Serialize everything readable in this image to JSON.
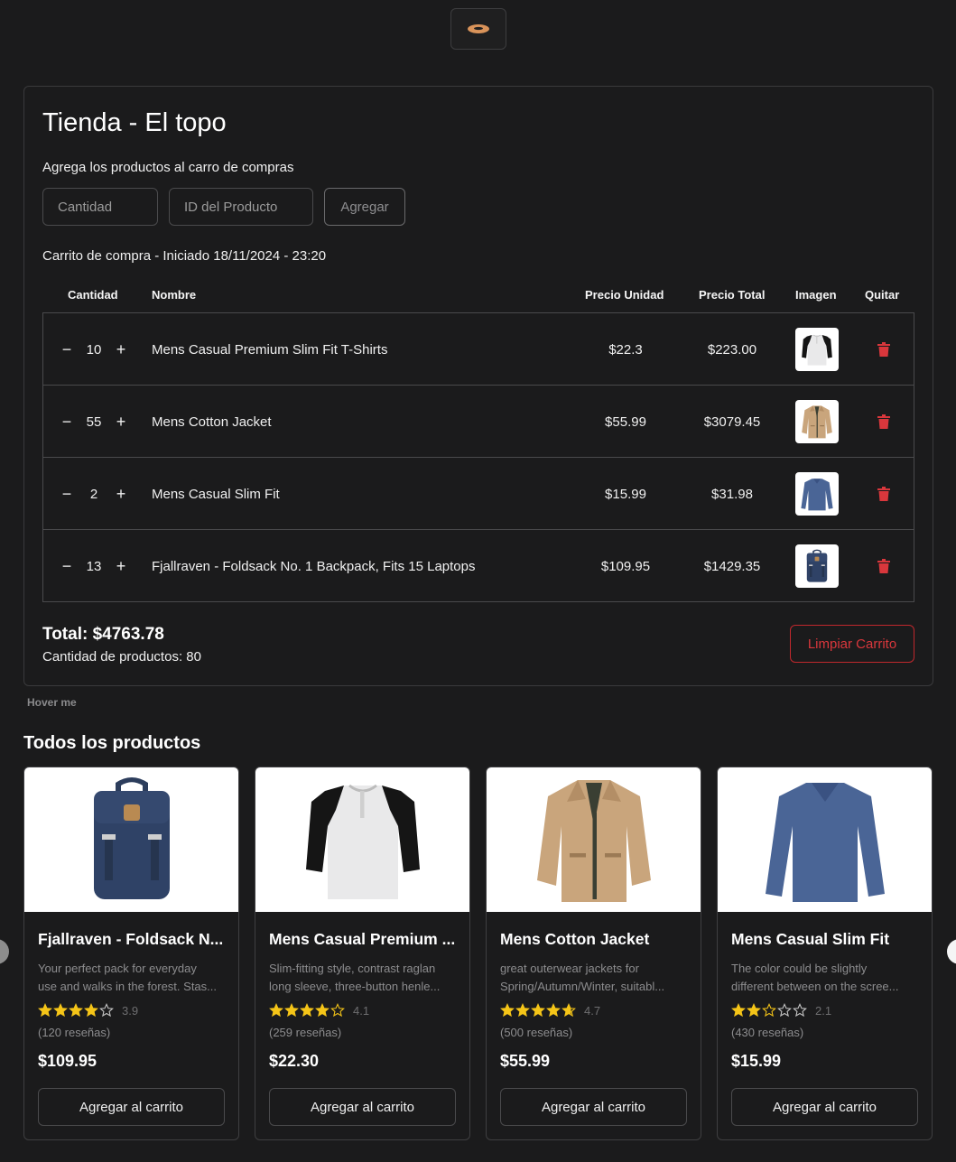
{
  "logo": {
    "icon": "bagel-icon"
  },
  "cart": {
    "title": "Tienda - El topo",
    "subtitle": "Agrega los productos al carro de compras",
    "qty_placeholder": "Cantidad",
    "id_placeholder": "ID del Producto",
    "add_label": "Agregar",
    "started": "Carrito de compra - Iniciado 18/11/2024 - 23:20",
    "headers": {
      "qty": "Cantidad",
      "name": "Nombre",
      "unit": "Precio Unidad",
      "total": "Precio Total",
      "image": "Imagen",
      "remove": "Quitar"
    },
    "rows": [
      {
        "qty": "10",
        "name": "Mens Casual Premium Slim Fit T-Shirts",
        "unit": "$22.3",
        "total": "$223.00",
        "image": "raglan-shirt"
      },
      {
        "qty": "55",
        "name": "Mens Cotton Jacket",
        "unit": "$55.99",
        "total": "$3079.45",
        "image": "jacket"
      },
      {
        "qty": "2",
        "name": "Mens Casual Slim Fit",
        "unit": "$15.99",
        "total": "$31.98",
        "image": "longsleeve"
      },
      {
        "qty": "13",
        "name": "Fjallraven - Foldsack No. 1 Backpack, Fits 15 Laptops",
        "unit": "$109.95",
        "total": "$1429.35",
        "image": "backpack"
      }
    ],
    "total_label": "Total: $4763.78",
    "count_label": "Cantidad de productos: 80",
    "clear_label": "Limpiar Carrito"
  },
  "hover_text": "Hover me",
  "products_title": "Todos los productos",
  "products": [
    {
      "title": "Fjallraven - Foldsack N...",
      "desc1": "Your perfect pack for everyday",
      "desc2": "use and walks in the forest. Stas...",
      "rating": 3.9,
      "rating_label": "3.9",
      "reviews": "(120 reseñas)",
      "price": "$109.95",
      "button": "Agregar al carrito",
      "image": "backpack"
    },
    {
      "title": "Mens Casual Premium ...",
      "desc1": "Slim-fitting style, contrast raglan",
      "desc2": "long sleeve, three-button henle...",
      "rating": 4.1,
      "rating_label": "4.1",
      "reviews": "(259 reseñas)",
      "price": "$22.30",
      "button": "Agregar al carrito",
      "image": "raglan-shirt"
    },
    {
      "title": "Mens Cotton Jacket",
      "desc1": "great outerwear jackets for",
      "desc2": "Spring/Autumn/Winter, suitabl...",
      "rating": 4.7,
      "rating_label": "4.7",
      "reviews": "(500 reseñas)",
      "price": "$55.99",
      "button": "Agregar al carrito",
      "image": "jacket"
    },
    {
      "title": "Mens Casual Slim Fit",
      "desc1": "The color could be slightly",
      "desc2": "different between on the scree...",
      "rating": 2.1,
      "rating_label": "2.1",
      "reviews": "(430 reseñas)",
      "price": "$15.99",
      "button": "Agregar al carrito",
      "image": "longsleeve"
    }
  ],
  "colors": {
    "background": "#1b1b1c",
    "danger": "#d9373c",
    "star": "#f5c518"
  }
}
